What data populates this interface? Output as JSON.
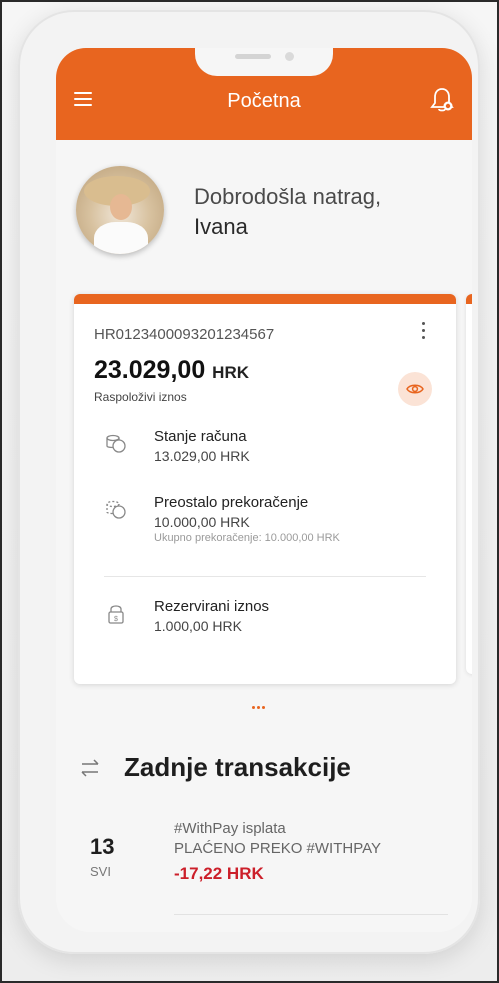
{
  "header": {
    "title": "Početna",
    "menu_icon": "hamburger-menu-icon",
    "bell_icon": "notification-bell-icon",
    "accent": "#e8651f"
  },
  "greeting": {
    "line1": "Dobrodošla natrag,",
    "name": "Ivana"
  },
  "account_card": {
    "iban": "HR0123400093201234567",
    "available_amount": "23.029,00",
    "currency": "HRK",
    "available_label": "Raspoloživi iznos",
    "rows": [
      {
        "icon": "coins-icon",
        "label": "Stanje računa",
        "value": "13.029,00 HRK"
      },
      {
        "icon": "overdraft-coins-icon",
        "label": "Preostalo prekoračenje",
        "value": "10.000,00 HRK",
        "note": "Ukupno prekoračenje: 10.000,00 HRK"
      },
      {
        "icon": "lock-icon",
        "label": "Rezervirani iznos",
        "value": "1.000,00 HRK"
      }
    ]
  },
  "transactions": {
    "title": "Zadnje transakcije",
    "items": [
      {
        "day": "13",
        "month": "SVI",
        "name": "#WithPay isplata",
        "description": "PLAĆENO PREKO #WITHPAY",
        "amount": "-17,22 HRK",
        "amount_color": "#cc1f2a"
      }
    ]
  }
}
